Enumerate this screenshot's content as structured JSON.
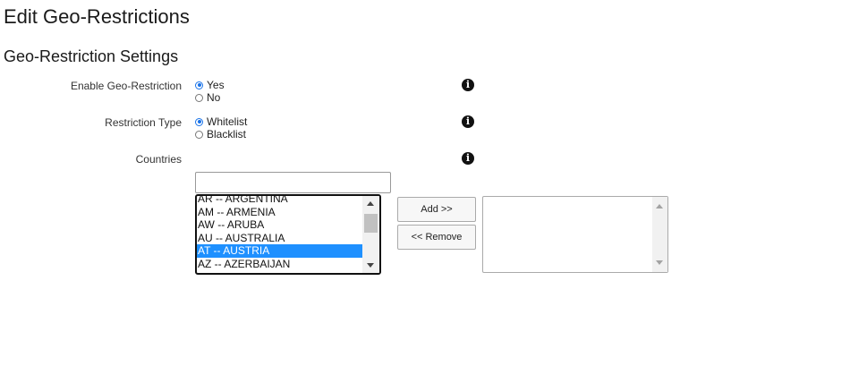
{
  "page": {
    "title": "Edit Geo-Restrictions"
  },
  "section": {
    "title": "Geo-Restriction Settings"
  },
  "enable_geo_restriction": {
    "label": "Enable Geo-Restriction",
    "options": [
      {
        "label": "Yes",
        "checked": true
      },
      {
        "label": "No",
        "checked": false
      }
    ]
  },
  "restriction_type": {
    "label": "Restriction Type",
    "options": [
      {
        "label": "Whitelist",
        "checked": true
      },
      {
        "label": "Blacklist",
        "checked": false
      }
    ]
  },
  "countries": {
    "label": "Countries",
    "search_value": "",
    "available": [
      {
        "label": "AR -- ARGENTINA",
        "selected": false
      },
      {
        "label": "AM -- ARMENIA",
        "selected": false
      },
      {
        "label": "AW -- ARUBA",
        "selected": false
      },
      {
        "label": "AU -- AUSTRALIA",
        "selected": false
      },
      {
        "label": "AT -- AUSTRIA",
        "selected": true
      },
      {
        "label": "AZ -- AZERBAIJAN",
        "selected": false
      }
    ],
    "add_button": "Add >>",
    "remove_button": "<< Remove",
    "chosen": []
  },
  "icons": {
    "info": "info-icon",
    "scroll_up": "scroll-up-arrow-icon",
    "scroll_down": "scroll-down-arrow-icon"
  },
  "colors": {
    "selection": "#1e90ff",
    "radio_accent": "#1a73e8"
  }
}
